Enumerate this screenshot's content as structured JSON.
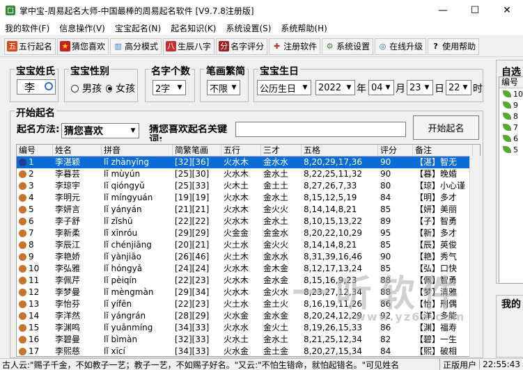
{
  "window": {
    "title": "掌中宝-周易起名大师-中国最棒的周易起名软件 [V9.7.8注册版]",
    "minimize": "—",
    "maximize": "☐",
    "close": "✕"
  },
  "menu": [
    "我的软件(F)",
    "信息操作(V)",
    "宝宝起名(N)",
    "起名知识(K)",
    "系统设置(S)",
    "系统帮助(H)"
  ],
  "toolbar": [
    {
      "label": "五行起名",
      "icon": "wuxing-icon",
      "glyph": "五",
      "color": "#d84a1b"
    },
    {
      "label": "猜您喜欢",
      "icon": "star-icon",
      "glyph": "★",
      "color": "#e0a000"
    },
    {
      "label": "高分模式",
      "icon": "chart-icon",
      "glyph": "▥",
      "color": "#3a7ac8"
    },
    {
      "label": "生辰八字",
      "icon": "calendar-icon",
      "glyph": "八",
      "color": "#c83030"
    },
    {
      "label": "名字评分",
      "icon": "score-icon",
      "glyph": "分",
      "color": "#a02020"
    },
    {
      "label": "注册软件",
      "icon": "register-icon",
      "glyph": "✚",
      "color": "#c03030"
    },
    {
      "label": "系统设置",
      "icon": "settings-icon",
      "glyph": "⚙",
      "color": "#408040"
    },
    {
      "label": "在线升级",
      "icon": "globe-icon",
      "glyph": "◎",
      "color": "#2a70c0"
    },
    {
      "label": "使用帮助",
      "icon": "help-icon",
      "glyph": "?",
      "color": "#202020"
    }
  ],
  "form": {
    "surname_title": "宝宝姓氏",
    "surname_value": "李",
    "gender_title": "宝宝性别",
    "gender_male": "男孩",
    "gender_female": "女孩",
    "count_title": "名字个数",
    "count_value": "2字",
    "trad_title": "笔画繁简",
    "trad_value": "不限",
    "birth_title": "宝宝生日",
    "calendar_value": "公历生日",
    "year_value": "2022",
    "year_unit": "年",
    "month_value": "04",
    "month_unit": "月",
    "day_value": "23",
    "day_unit": "日",
    "hour_value": "22",
    "hour_unit": "时",
    "start_title": "开始起名",
    "method_label": "起名方法:",
    "method_value": "猜您喜欢",
    "keyword_label": "猜您喜欢起名关键词:",
    "keyword_value": "",
    "start_button": "开始起名"
  },
  "grid": {
    "headers": [
      "编号",
      "姓名",
      "拼音",
      "简繁笔画",
      "五行",
      "三才",
      "五格",
      "评分",
      "备注"
    ],
    "rows": [
      [
        "1",
        "李湛颖",
        "lǐ zhànyǐng",
        "[32][36]",
        "火水木",
        "金水水",
        "8,20,29,17,36",
        "90",
        "【湛】智无"
      ],
      [
        "2",
        "李暮芸",
        "lǐ mùyún",
        "[25][30]",
        "火水木",
        "金水土",
        "8,22,25,11,32",
        "90",
        "【暮】晚婚"
      ],
      [
        "3",
        "李琼宇",
        "lǐ qióngyǔ",
        "[25][33]",
        "火木土",
        "金土土",
        "8,27,26,7,33",
        "80",
        "【琼】小心谨"
      ],
      [
        "4",
        "李明元",
        "lǐ míngyuán",
        "[19][19]",
        "火水木",
        "金水土",
        "8,15,12,5,19",
        "84",
        "【明】多才"
      ],
      [
        "5",
        "李妍言",
        "lǐ yányán",
        "[21][21]",
        "火水木",
        "金火火",
        "8,14,14,8,21",
        "85",
        "【妍】美丽"
      ],
      [
        "6",
        "李子舒",
        "lǐ zǐshū",
        "[22][22]",
        "火水木",
        "金水土",
        "8,10,15,13,22",
        "89",
        "【子】智勇"
      ],
      [
        "7",
        "李新柔",
        "lǐ xīnróu",
        "[29][29]",
        "火金金",
        "金金水",
        "8,20,22,10,29",
        "95",
        "【新】多才"
      ],
      [
        "8",
        "李辰江",
        "lǐ chénjiāng",
        "[20][21]",
        "火土水",
        "金火火",
        "8,14,14,8,21",
        "85",
        "【辰】英俊"
      ],
      [
        "9",
        "李艳娇",
        "lǐ yànjiāo",
        "[26][46]",
        "火土木",
        "金水水",
        "8,31,39,16,46",
        "90",
        "【艳】秀气"
      ],
      [
        "10",
        "李弘雅",
        "lǐ hóngyǎ",
        "[24][24]",
        "火水木",
        "金木金",
        "8,12,17,13,24",
        "85",
        "【弘】口快"
      ],
      [
        "11",
        "李佩芹",
        "lǐ pèiqín",
        "[22][23]",
        "火水木",
        "金水金",
        "8,15,16,9,23",
        "88",
        "【佩】智勇"
      ],
      [
        "12",
        "李梦曼",
        "lǐ mèngmàn",
        "[29][34]",
        "火水木",
        "金火水",
        "8,23,27,12,34",
        "88",
        "【梦】清雅"
      ],
      [
        "13",
        "李怡芬",
        "lǐ yífēn",
        "[22][23]",
        "火土水",
        "金土火",
        "8,16,19,11,26",
        "86",
        "【怡】刑偶"
      ],
      [
        "14",
        "李洋然",
        "lǐ yángrán",
        "[28][29]",
        "火水金",
        "金水金",
        "8,20,24,12,29",
        "92",
        "【洋】多能"
      ],
      [
        "15",
        "李渊鸣",
        "lǐ yuānmíng",
        "[34][33]",
        "火水水",
        "金火土",
        "8,19,26,15,33",
        "86",
        "【渊】福寿"
      ],
      [
        "16",
        "李碧曼",
        "lǐ bìmàn",
        "[32][33]",
        "火水土",
        "金水土",
        "8,21,25,12,34",
        "82",
        "【碧】一生"
      ],
      [
        "17",
        "李熙慈",
        "lǐ xīcí",
        "[34][33]",
        "火水金",
        "金土金",
        "8,20,27,15,34",
        "84",
        "【熙】破相"
      ]
    ]
  },
  "right_panel": {
    "title": "自选",
    "list_header": "编号",
    "items": [
      "10",
      "9",
      "8",
      "7",
      "6",
      "5"
    ],
    "bottom_title": "我的"
  },
  "watermark": {
    "text": "一听软件",
    "url": "www.yz6a.com"
  },
  "status": {
    "message": "古人云:\"赐子千金，不如教子一艺；教子一艺，不如赐子好名。\"又云:\"不怕生错命，就怕起错名。\"可见姓名",
    "user": "正版用户",
    "time": "22:55:43"
  }
}
